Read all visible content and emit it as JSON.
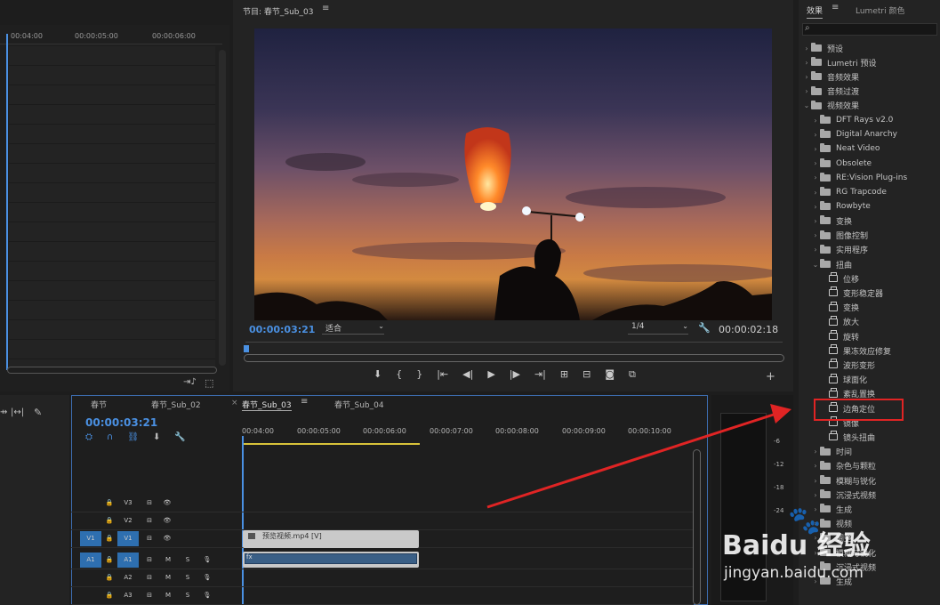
{
  "source_monitor": {
    "timecodes": [
      "00:04:00",
      "00:00:05:00",
      "00:00:06:00"
    ]
  },
  "program_monitor": {
    "title": "节目: 春节_Sub_03",
    "current_time": "00:00:03:21",
    "fit_option": "适合",
    "resolution_option": "1/4",
    "duration": "00:00:02:18"
  },
  "effects_panel": {
    "tab_effects": "效果",
    "tab_lumetri": "Lumetri 颜色",
    "search_placeholder": "",
    "items": [
      {
        "label": "预设",
        "type": "folder",
        "level": 0,
        "expanded": false
      },
      {
        "label": "Lumetri 预设",
        "type": "folder",
        "level": 0,
        "expanded": false
      },
      {
        "label": "音频效果",
        "type": "folder",
        "level": 0,
        "expanded": false
      },
      {
        "label": "音频过渡",
        "type": "folder",
        "level": 0,
        "expanded": false
      },
      {
        "label": "视频效果",
        "type": "folder",
        "level": 0,
        "expanded": true
      },
      {
        "label": "DFT Rays v2.0",
        "type": "folder",
        "level": 1,
        "expanded": false
      },
      {
        "label": "Digital Anarchy",
        "type": "folder",
        "level": 1,
        "expanded": false
      },
      {
        "label": "Neat Video",
        "type": "folder",
        "level": 1,
        "expanded": false
      },
      {
        "label": "Obsolete",
        "type": "folder",
        "level": 1,
        "expanded": false
      },
      {
        "label": "RE:Vision Plug-ins",
        "type": "folder",
        "level": 1,
        "expanded": false
      },
      {
        "label": "RG Trapcode",
        "type": "folder",
        "level": 1,
        "expanded": false
      },
      {
        "label": "Rowbyte",
        "type": "folder",
        "level": 1,
        "expanded": false
      },
      {
        "label": "变换",
        "type": "folder",
        "level": 1,
        "expanded": false
      },
      {
        "label": "图像控制",
        "type": "folder",
        "level": 1,
        "expanded": false
      },
      {
        "label": "实用程序",
        "type": "folder",
        "level": 1,
        "expanded": false
      },
      {
        "label": "扭曲",
        "type": "folder",
        "level": 1,
        "expanded": true
      },
      {
        "label": "位移",
        "type": "effect",
        "level": 2
      },
      {
        "label": "变形稳定器",
        "type": "effect",
        "level": 2
      },
      {
        "label": "变换",
        "type": "effect",
        "level": 2
      },
      {
        "label": "放大",
        "type": "effect",
        "level": 2
      },
      {
        "label": "旋转",
        "type": "effect",
        "level": 2
      },
      {
        "label": "果冻效应修复",
        "type": "effect",
        "level": 2
      },
      {
        "label": "波形变形",
        "type": "effect",
        "level": 2
      },
      {
        "label": "球面化",
        "type": "effect",
        "level": 2
      },
      {
        "label": "紊乱置换",
        "type": "effect",
        "level": 2
      },
      {
        "label": "边角定位",
        "type": "effect",
        "level": 2,
        "highlighted": true
      },
      {
        "label": "镜像",
        "type": "effect",
        "level": 2
      },
      {
        "label": "镜头扭曲",
        "type": "effect",
        "level": 2
      },
      {
        "label": "时间",
        "type": "folder",
        "level": 1,
        "expanded": false
      },
      {
        "label": "杂色与颗粒",
        "type": "folder",
        "level": 1,
        "expanded": false
      },
      {
        "label": "模糊与锐化",
        "type": "folder",
        "level": 1,
        "expanded": false
      },
      {
        "label": "沉浸式视频",
        "type": "folder",
        "level": 1,
        "expanded": false
      },
      {
        "label": "生成",
        "type": "folder",
        "level": 1,
        "expanded": false
      },
      {
        "label": "视频",
        "type": "folder",
        "level": 1,
        "expanded": false
      },
      {
        "label": "调整",
        "type": "folder",
        "level": 1,
        "expanded": false
      },
      {
        "label": "模糊与锐化",
        "type": "folder",
        "level": 1,
        "expanded": false
      },
      {
        "label": "沉浸式视频",
        "type": "folder",
        "level": 1,
        "expanded": false
      },
      {
        "label": "生成",
        "type": "folder",
        "level": 1,
        "expanded": false
      }
    ]
  },
  "timeline": {
    "tabs": [
      "春节",
      "春节_Sub_02",
      "春节_Sub_03",
      "春节_Sub_04"
    ],
    "active_tab": 2,
    "current_time": "00:00:03:21",
    "ruler_labels": [
      "00:04:00",
      "00:00:05:00",
      "00:00:06:00",
      "00:00:07:00",
      "00:00:08:00",
      "00:00:09:00",
      "00:00:10:00"
    ],
    "tracks": [
      {
        "name": "V3",
        "src": ""
      },
      {
        "name": "V2",
        "src": ""
      },
      {
        "name": "V1",
        "src": "V1"
      },
      {
        "name": "A1",
        "src": "A1"
      },
      {
        "name": "A2",
        "src": ""
      },
      {
        "name": "A3",
        "src": ""
      }
    ],
    "track_buttons": [
      "M",
      "S"
    ],
    "video_clip_label": "预览视频.mp4 [V]",
    "audio_clip_label": "fx"
  },
  "meter_labels": [
    "-6",
    "-12",
    "-18",
    "-24"
  ],
  "watermark": {
    "brand": "Baidu 经验",
    "url": "jingyan.baidu.com"
  },
  "colors": {
    "accent_blue": "#4a90e2",
    "highlight_red": "#e02424",
    "playhead_yellow": "#d8c23a"
  }
}
